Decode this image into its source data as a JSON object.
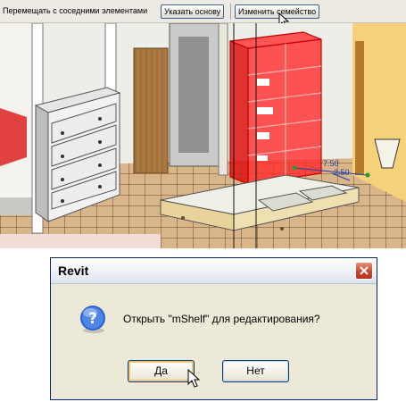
{
  "toolbar": {
    "move_with_neighbors_label": "Перемещать с соседними элементами",
    "pick_host_label": "Указать основу",
    "edit_family_label": "Изменить семейство"
  },
  "viewport": {
    "dimension_label_1": "7.50",
    "dimension_label_2": "2.50",
    "highlight_color": "#ff2a2a"
  },
  "dialog": {
    "title": "Revit",
    "message": "Открыть \"mShelf\" для редактирования?",
    "yes_label": "Да",
    "no_label": "Нет",
    "icon": "question-icon"
  }
}
